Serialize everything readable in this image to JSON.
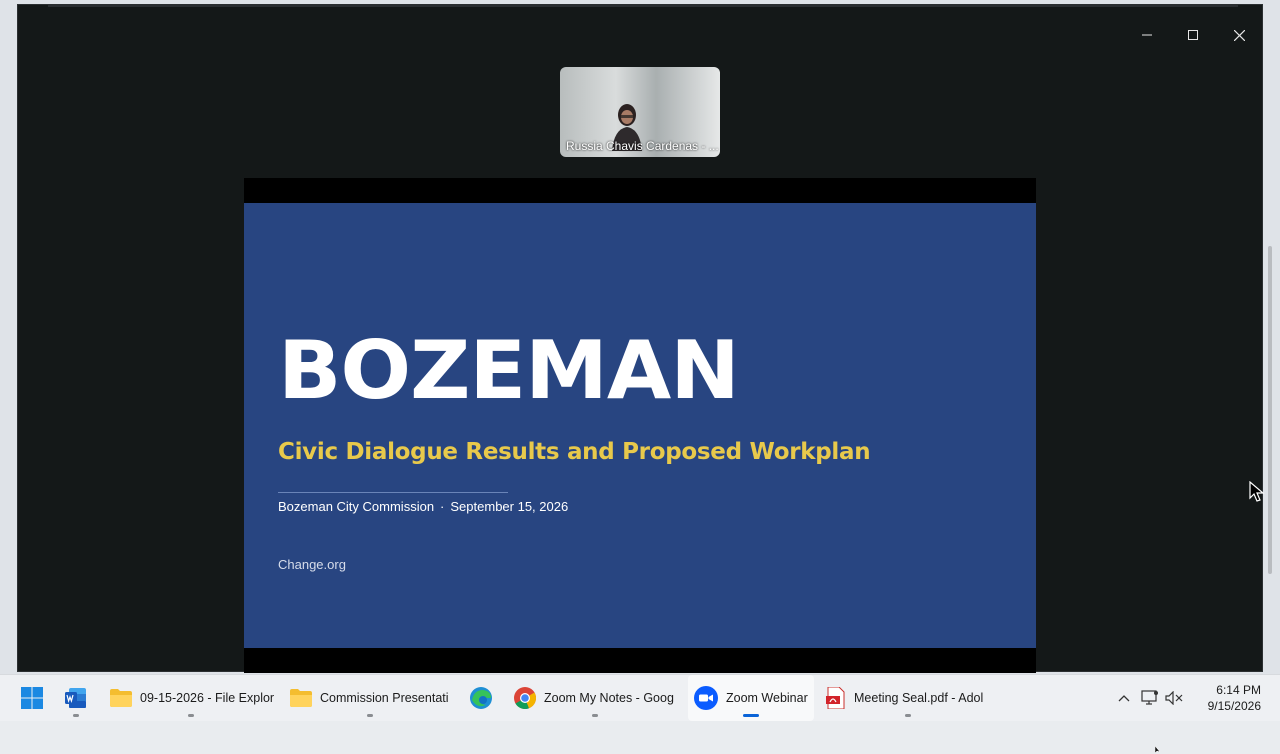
{
  "window": {
    "controls": {
      "minimize_icon": "minimize-icon",
      "maximize_icon": "maximize-icon",
      "close_icon": "close-icon"
    }
  },
  "participant": {
    "name": "Russia Chavis Cardenas - ..."
  },
  "slide": {
    "title": "BOZEMAN",
    "subtitle": "Civic Dialogue Results and Proposed Workplan",
    "organization": "Bozeman City Commission",
    "separator": "·",
    "date": "September 15, 2026",
    "brand": "Change.org",
    "colors": {
      "background": "#284581",
      "subtitle": "#e8c94b"
    }
  },
  "taskbar": {
    "start_icon": "windows-start-icon",
    "items": [
      {
        "label": "",
        "icon": "word-icon"
      },
      {
        "label": "09-15-2026 - File Explor",
        "icon": "folder-icon"
      },
      {
        "label": "Commission Presentatio",
        "icon": "folder-icon"
      },
      {
        "label": "",
        "icon": "edge-icon"
      },
      {
        "label": "Zoom My Notes - Goog",
        "icon": "chrome-icon"
      },
      {
        "label": "Zoom Webinar",
        "icon": "zoom-icon"
      },
      {
        "label": "Meeting Seal.pdf - Adol",
        "icon": "pdf-icon"
      }
    ],
    "tray": {
      "chevron_icon": "chevron-up-icon",
      "network_icon": "network-icon",
      "volume_icon": "volume-muted-icon"
    },
    "clock": {
      "time": "6:14 PM",
      "date": "9/15/2026"
    }
  }
}
